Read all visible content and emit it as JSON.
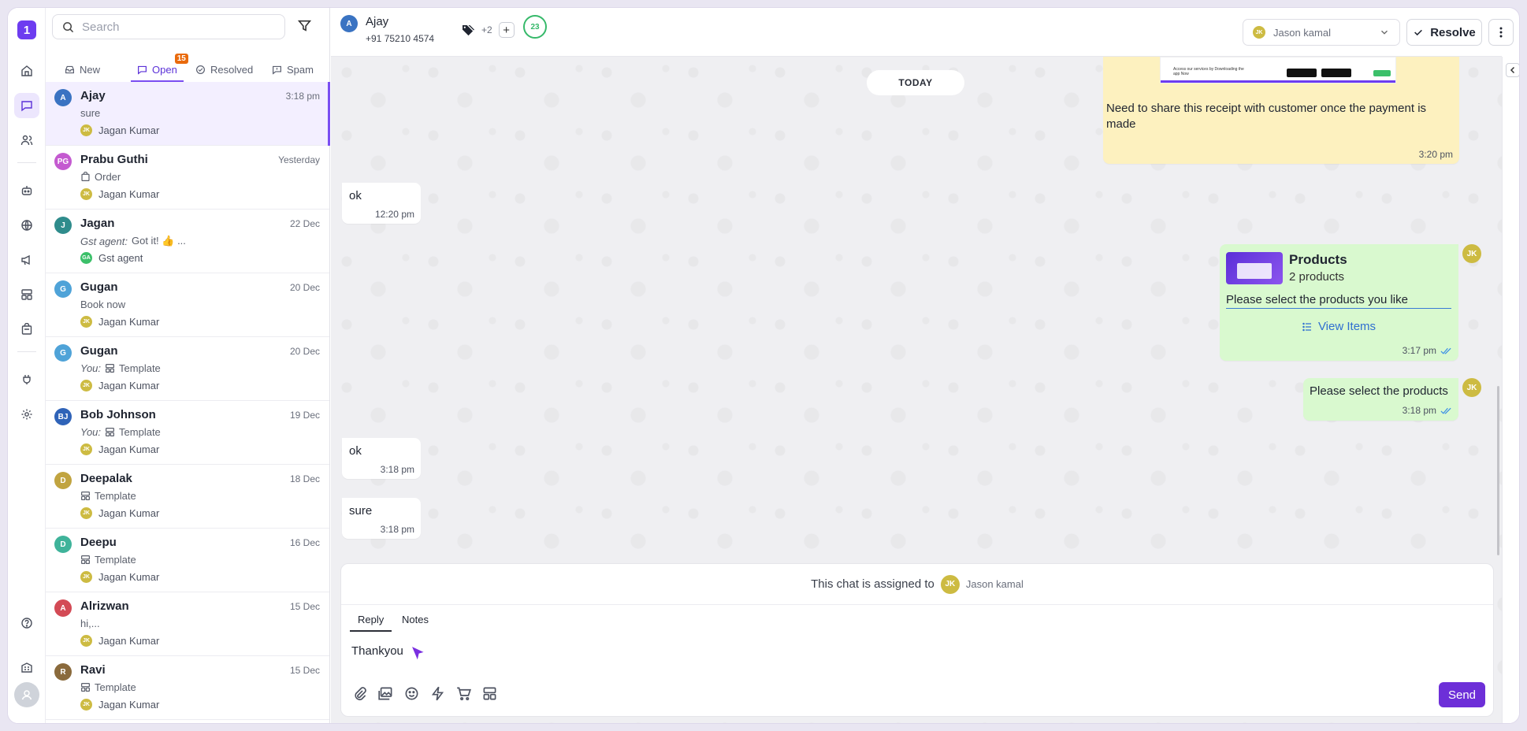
{
  "rail": {
    "logo": "1",
    "items": [
      "home-icon",
      "chat-icon",
      "contacts-icon",
      "bot-icon",
      "globe-icon",
      "megaphone-icon",
      "template-icon",
      "catalog-icon",
      "plug-icon",
      "settings-icon",
      "help-icon",
      "building-icon"
    ]
  },
  "list": {
    "search_placeholder": "Search",
    "tabs": [
      {
        "label": "New"
      },
      {
        "label": "Open",
        "badge": "15"
      },
      {
        "label": "Resolved"
      },
      {
        "label": "Spam"
      }
    ],
    "conversations": [
      {
        "initials": "A",
        "color": "#3a73c2",
        "name": "Ajay",
        "time": "3:18 pm",
        "preview": "sure",
        "agent_initials": "JK",
        "agent": "Jagan Kumar"
      },
      {
        "initials": "PG",
        "color": "#c45ad0",
        "name": "Prabu Guthi",
        "time": "Yesterday",
        "preview": "Order",
        "agent_initials": "JK",
        "agent": "Jagan Kumar"
      },
      {
        "initials": "J",
        "color": "#2f8c8c",
        "name": "Jagan",
        "time": "22 Dec",
        "preview_label": "Gst agent:",
        "preview": "Got it! 👍 ...",
        "agent_initials": "GA",
        "agent": "Gst agent"
      },
      {
        "initials": "G",
        "color": "#4fa3d8",
        "name": "Gugan",
        "time": "20 Dec",
        "preview": "Book now",
        "agent_initials": "JK",
        "agent": "Jagan Kumar"
      },
      {
        "initials": "G",
        "color": "#4fa3d8",
        "name": "Gugan",
        "time": "20 Dec",
        "preview_label": "You:",
        "preview": "Template",
        "agent_initials": "JK",
        "agent": "Jagan Kumar"
      },
      {
        "initials": "BJ",
        "color": "#2f63b8",
        "name": "Bob Johnson",
        "time": "19 Dec",
        "preview_label": "You:",
        "preview": "Template",
        "agent_initials": "JK",
        "agent": "Jagan Kumar"
      },
      {
        "initials": "D",
        "color": "#c1a440",
        "name": "Deepalak",
        "time": "18 Dec",
        "preview": "Template",
        "agent_initials": "JK",
        "agent": "Jagan Kumar"
      },
      {
        "initials": "D",
        "color": "#3fb39a",
        "name": "Deepu",
        "time": "16 Dec",
        "preview": "Template",
        "agent_initials": "JK",
        "agent": "Jagan Kumar"
      },
      {
        "initials": "A",
        "color": "#d34a55",
        "name": "Alrizwan",
        "time": "15 Dec",
        "preview": "hi,...",
        "agent_initials": "JK",
        "agent": "Jagan Kumar"
      },
      {
        "initials": "R",
        "color": "#8a6a3c",
        "name": "Ravi",
        "time": "15 Dec",
        "preview": "Template",
        "agent_initials": "JK",
        "agent": "Jagan Kumar"
      }
    ]
  },
  "header": {
    "initials": "A",
    "name": "Ajay",
    "phone": "+91 75210 4574",
    "tag_count": "+2",
    "ring_count": "23",
    "assignee_initials": "JK",
    "assignee": "Jason kamal",
    "resolve_label": "Resolve"
  },
  "messages": {
    "day_label": "TODAY",
    "note_text": "Need to share this receipt with customer once the payment is made",
    "note_time": "3:20 pm",
    "receipt_text": "Access our services by Downloading the app Now",
    "in1_text": "ok",
    "in1_time": "12:20 pm",
    "products_title": "Products",
    "products_count": "2 products",
    "products_body": "Please select the products you like",
    "products_cta": "View Items",
    "products_time": "3:17 pm",
    "agent_initials": "JK",
    "out2_text": "Please select the products",
    "out2_time": "3:18 pm",
    "in2_text": "ok",
    "in2_time": "3:18 pm",
    "in3_text": "sure",
    "in3_time": "3:18 pm"
  },
  "composer": {
    "assigned_prefix": "This chat is assigned to",
    "assigned_initials": "JK",
    "assigned_name": "Jason kamal",
    "tab_reply": "Reply",
    "tab_notes": "Notes",
    "value": "Thankyou",
    "send_label": "Send"
  }
}
